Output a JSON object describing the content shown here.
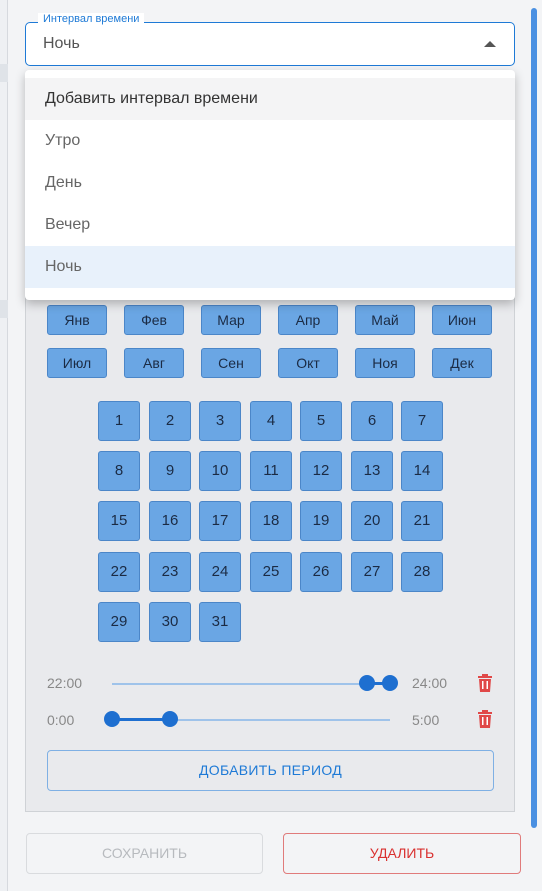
{
  "select": {
    "legend": "Интервал времени",
    "value": "Ночь",
    "options": [
      "Добавить интервал времени",
      "Утро",
      "День",
      "Вечер",
      "Ночь"
    ]
  },
  "months": [
    "Янв",
    "Фев",
    "Мар",
    "Апр",
    "Май",
    "Июн",
    "Июл",
    "Авг",
    "Сен",
    "Окт",
    "Ноя",
    "Дек"
  ],
  "days": [
    "1",
    "2",
    "3",
    "4",
    "5",
    "6",
    "7",
    "8",
    "9",
    "10",
    "11",
    "12",
    "13",
    "14",
    "15",
    "16",
    "17",
    "18",
    "19",
    "20",
    "21",
    "22",
    "23",
    "24",
    "25",
    "26",
    "27",
    "28",
    "29",
    "30",
    "31"
  ],
  "periods": [
    {
      "start": "22:00",
      "end": "24:00"
    },
    {
      "start": "0:00",
      "end": "5:00"
    }
  ],
  "buttons": {
    "add_period": "ДОБАВИТЬ ПЕРИОД",
    "save": "СОХРАНИТЬ",
    "delete": "УДАЛИТЬ"
  },
  "colors": {
    "accent": "#1e7ad6",
    "chip": "#6aa6e4",
    "danger": "#d9302f"
  },
  "icons": {
    "trash": "trash-icon",
    "caret": "caret-up-icon"
  }
}
